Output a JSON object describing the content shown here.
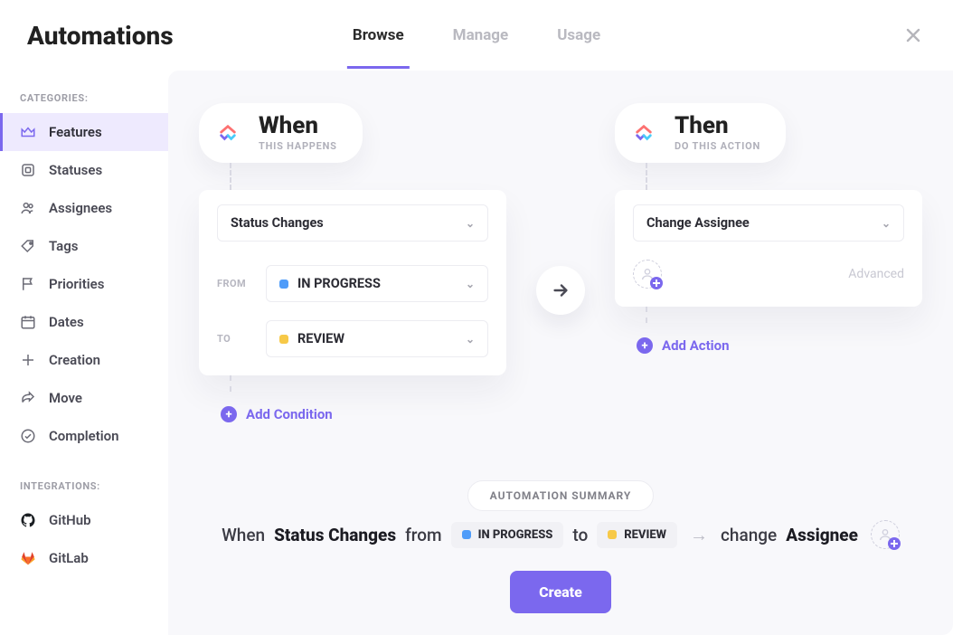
{
  "header": {
    "title": "Automations",
    "tabs": [
      "Browse",
      "Manage",
      "Usage"
    ],
    "active_tab": 0
  },
  "sidebar": {
    "categories_heading": "CATEGORIES:",
    "integrations_heading": "INTEGRATIONS:",
    "items": [
      {
        "label": "Features"
      },
      {
        "label": "Statuses"
      },
      {
        "label": "Assignees"
      },
      {
        "label": "Tags"
      },
      {
        "label": "Priorities"
      },
      {
        "label": "Dates"
      },
      {
        "label": "Creation"
      },
      {
        "label": "Move"
      },
      {
        "label": "Completion"
      }
    ],
    "integrations": [
      {
        "label": "GitHub"
      },
      {
        "label": "GitLab"
      }
    ]
  },
  "when": {
    "title": "When",
    "subtitle": "THIS HAPPENS",
    "trigger": "Status Changes",
    "from_label": "FROM",
    "to_label": "TO",
    "from_status": {
      "name": "IN PROGRESS",
      "color": "#4f9cf9"
    },
    "to_status": {
      "name": "REVIEW",
      "color": "#f7c948"
    },
    "add_condition": "Add Condition"
  },
  "then": {
    "title": "Then",
    "subtitle": "DO THIS ACTION",
    "action": "Change Assignee",
    "advanced": "Advanced",
    "add_action": "Add Action"
  },
  "summary": {
    "heading": "AUTOMATION SUMMARY",
    "w_when": "When",
    "w_trigger": "Status Changes",
    "w_from": "from",
    "w_to": "to",
    "w_change": "change",
    "w_assignee": "Assignee",
    "create": "Create"
  },
  "colors": {
    "accent": "#7b68ee"
  }
}
